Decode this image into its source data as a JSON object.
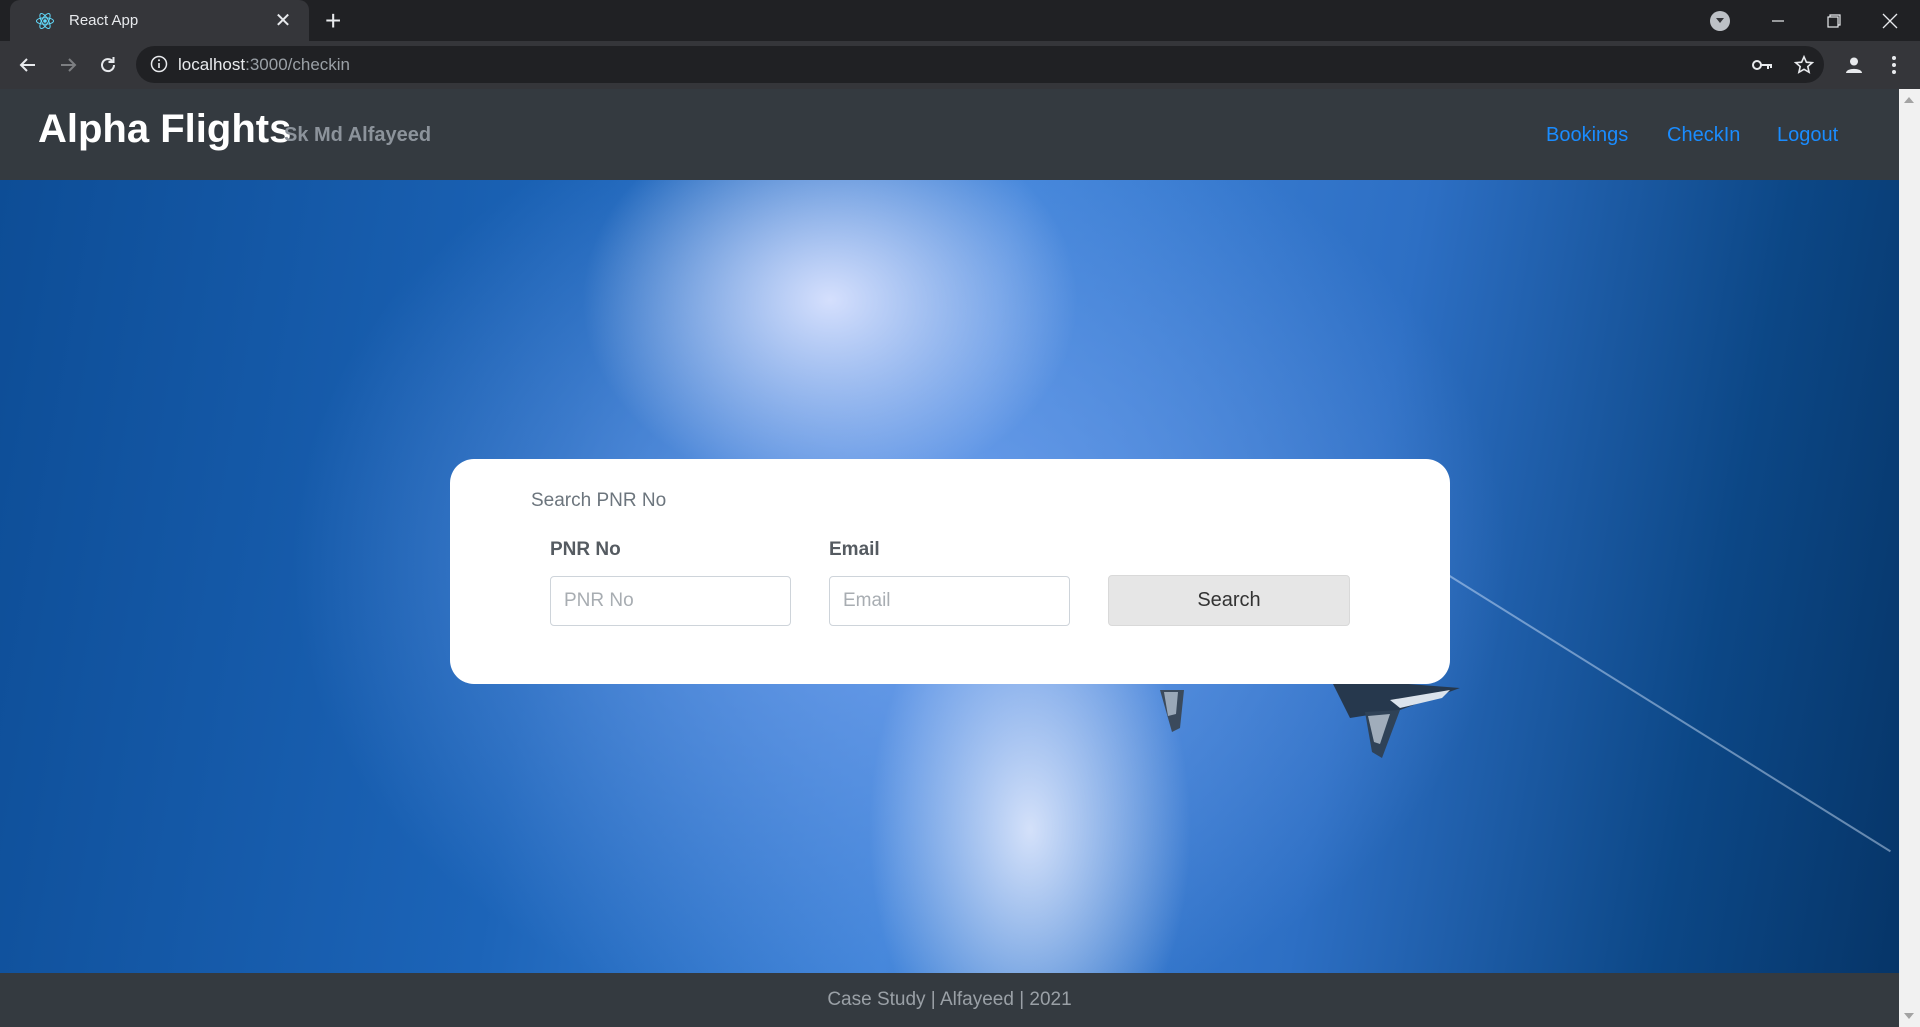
{
  "browser": {
    "tab_title": "React App",
    "url_host": "localhost",
    "url_path": ":3000/checkin"
  },
  "site": {
    "brand": "Alpha Flights",
    "user_name": "Sk Md Alfayeed",
    "nav": [
      "Bookings",
      "CheckIn",
      "Logout"
    ]
  },
  "search_form": {
    "title": "Search PNR No",
    "pnr_label": "PNR No",
    "pnr_placeholder": "PNR No",
    "pnr_value": "",
    "email_label": "Email",
    "email_placeholder": "Email",
    "email_value": "",
    "button_label": "Search"
  },
  "footer": {
    "text": "Case Study | Alfayeed | 2021"
  },
  "colors": {
    "header_bg": "#343a40",
    "nav_link": "#1a8cff",
    "hero_blue": "#1c64b8"
  },
  "icons": [
    "react-icon",
    "close-icon",
    "plus-icon",
    "back-icon",
    "forward-icon",
    "reload-icon",
    "info-icon",
    "key-icon",
    "star-icon",
    "account-icon",
    "menu-icon",
    "minimize-icon",
    "maximize-icon",
    "window-close-icon",
    "profile-dropdown-icon",
    "airplane-icon"
  ]
}
